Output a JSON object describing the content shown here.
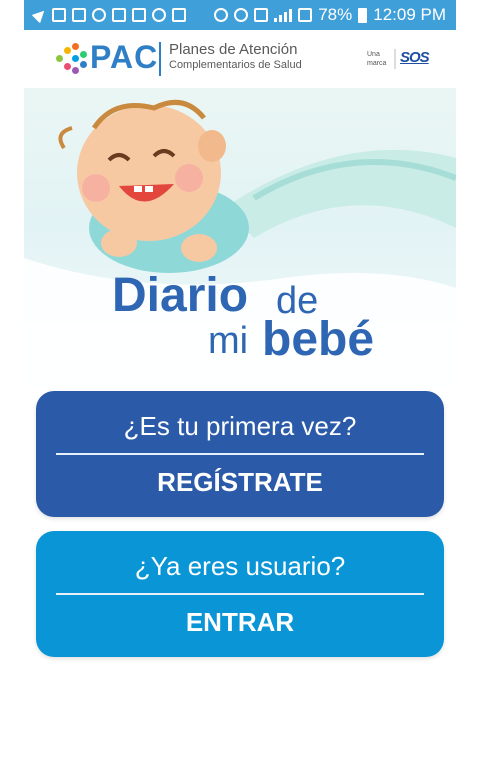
{
  "status_bar": {
    "battery": "78%",
    "time": "12:09 PM"
  },
  "brand": {
    "pac": "PAC",
    "line1": "Planes de Atención",
    "line2": "Complementarios de Salud",
    "una_marca": "Una marca",
    "sos": "SOS"
  },
  "hero": {
    "title_diario": "Diario",
    "title_de": "de",
    "title_mi": "mi",
    "title_bebe": "bebé"
  },
  "register_card": {
    "question": "¿Es tu primera vez?",
    "action": "REGÍSTRATE"
  },
  "login_card": {
    "question": "¿Ya eres usuario?",
    "action": "ENTRAR"
  },
  "colors": {
    "status_bar": "#3f9fd8",
    "brand_blue": "#2f66b3",
    "register": "#2a5aa8",
    "login": "#0a95d6"
  }
}
